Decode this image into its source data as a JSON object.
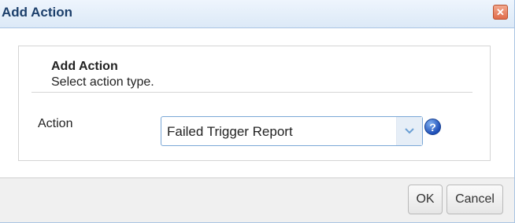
{
  "dialog": {
    "title": "Add Action",
    "close_glyph": "✕"
  },
  "panel": {
    "heading": "Add Action",
    "subheading": "Select action type."
  },
  "form": {
    "action_label": "Action",
    "action_value": "Failed Trigger Report",
    "help_glyph": "?"
  },
  "footer": {
    "ok_label": "OK",
    "cancel_label": "Cancel"
  },
  "icons": {
    "close": "close-icon",
    "dropdown": "chevron-down-icon",
    "help": "help-icon"
  },
  "colors": {
    "title_text": "#1c3f6b",
    "close_button": "#e06b4a",
    "select_border": "#7aa7d6",
    "help_icon": "#1f4fb8"
  }
}
